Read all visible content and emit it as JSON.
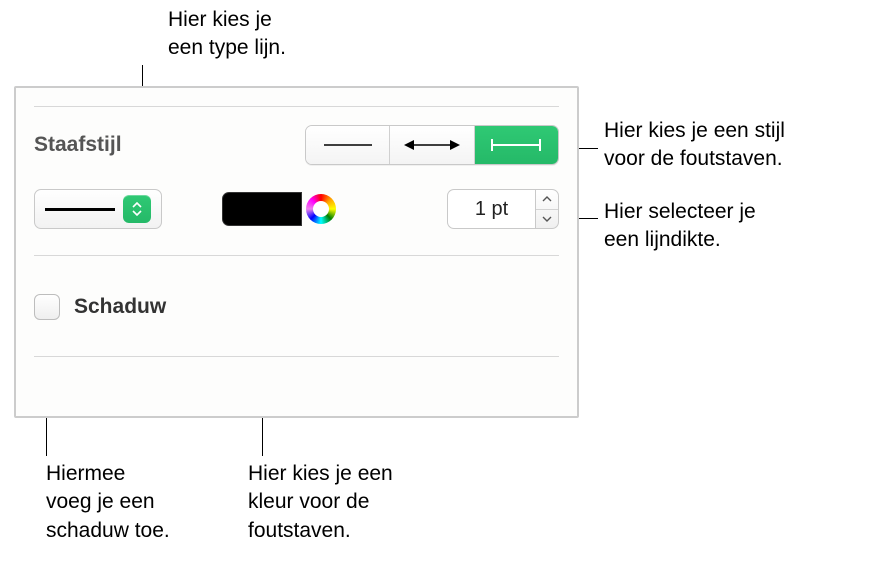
{
  "callouts": {
    "line_type": "Hier kies je\neen type lijn.",
    "error_bar_style": "Hier kies je een stijl\nvoor de foutstaven.",
    "thickness": "Hier selecteer je\neen lijndikte.",
    "shadow_add": "Hiermee\nvoeg je een\nschaduw toe.",
    "color": "Hier kies je een\nkleur voor de\nfoutstaven."
  },
  "panel": {
    "section_bar_style": "Staafstijl",
    "shadow_checkbox_label": "Schaduw",
    "thickness_value": "1 pt",
    "line_style_options": [
      "solid"
    ],
    "selected_line_style": "solid",
    "color_swatch": "#000000",
    "error_bar_styles": [
      "line",
      "capped-arrow",
      "capped-line"
    ],
    "selected_error_bar_style": "capped-line"
  }
}
